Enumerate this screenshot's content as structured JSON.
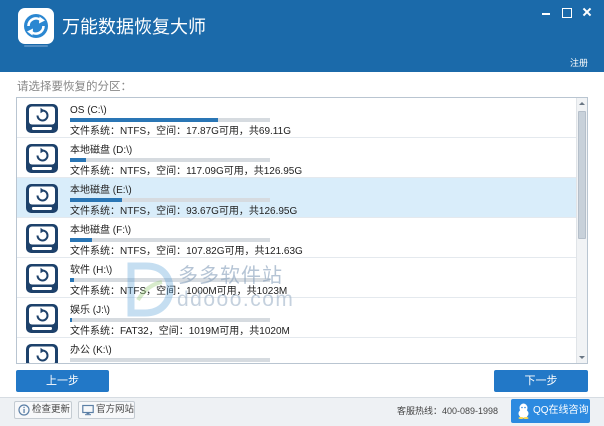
{
  "window": {
    "title": "万能数据恢复大师",
    "register_label": "注册"
  },
  "main": {
    "prompt": "请选择要恢复的分区：",
    "partitions": [
      {
        "name": "OS (C:\\)",
        "info": "文件系统：NTFS，空间：17.87G可用，共69.11G",
        "used_fraction": 0.74
      },
      {
        "name": "本地磁盘 (D:\\)",
        "info": "文件系统：NTFS，空间：117.09G可用，共126.95G",
        "used_fraction": 0.08
      },
      {
        "name": "本地磁盘 (E:\\)",
        "info": "文件系统：NTFS，空间：93.67G可用，共126.95G",
        "used_fraction": 0.26,
        "selected": true
      },
      {
        "name": "本地磁盘 (F:\\)",
        "info": "文件系统：NTFS，空间：107.82G可用，共121.63G",
        "used_fraction": 0.11
      },
      {
        "name": "软件 (H:\\)",
        "info": "文件系统：NTFS，空间：1000M可用，共1023M",
        "used_fraction": 0.02
      },
      {
        "name": "娱乐 (J:\\)",
        "info": "文件系统：FAT32，空间：1019M可用，共1020M",
        "used_fraction": 0.01
      },
      {
        "name": "办公 (K:\\)",
        "used_fraction": 0
      }
    ]
  },
  "nav": {
    "prev_label": "上一步",
    "next_label": "下一步"
  },
  "footer": {
    "check_update_label": "检查更新",
    "website_label": "官方网站",
    "hotline": "客服热线：400-089-1998",
    "qq_label": "QQ在线咨询"
  },
  "watermark": {
    "name": "多多软件站",
    "url": "ddooo.com"
  },
  "icons": {
    "logo": "refresh-drive-logo",
    "partition": "drive-icon",
    "check_update": "info-icon",
    "website": "monitor-icon",
    "qq": "qq-penguin-icon"
  },
  "colors": {
    "titlebar": "#1b6aaa",
    "accent": "#2278c7",
    "selected_row": "#d9edfa",
    "usage_fill": "#2a76b5",
    "footer": "#eef1f4",
    "qq_button": "#2c8ae0"
  }
}
